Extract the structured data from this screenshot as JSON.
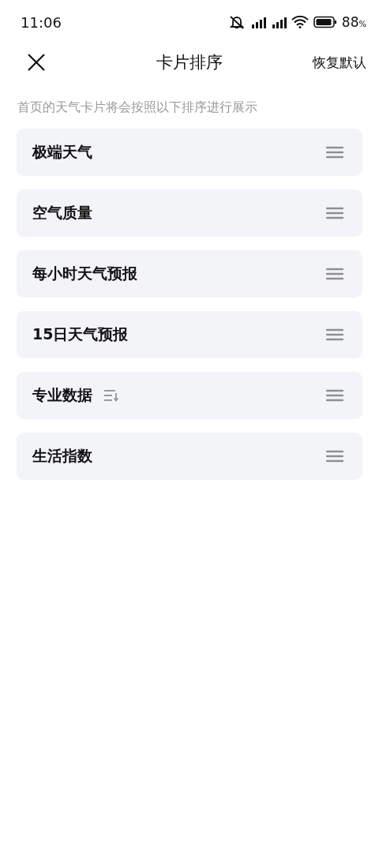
{
  "status_bar": {
    "time": "11:06",
    "battery": "88",
    "battery_unit": "%"
  },
  "header": {
    "title": "卡片排序",
    "action": "恢复默认"
  },
  "subtitle": "首页的天气卡片将会按照以下排序进行展示",
  "cards": [
    {
      "label": "极端天气",
      "has_sort": false
    },
    {
      "label": "空气质量",
      "has_sort": false
    },
    {
      "label": "每小时天气预报",
      "has_sort": false
    },
    {
      "label": "15日天气预报",
      "has_sort": false
    },
    {
      "label": "专业数据",
      "has_sort": true
    },
    {
      "label": "生活指数",
      "has_sort": false
    }
  ]
}
